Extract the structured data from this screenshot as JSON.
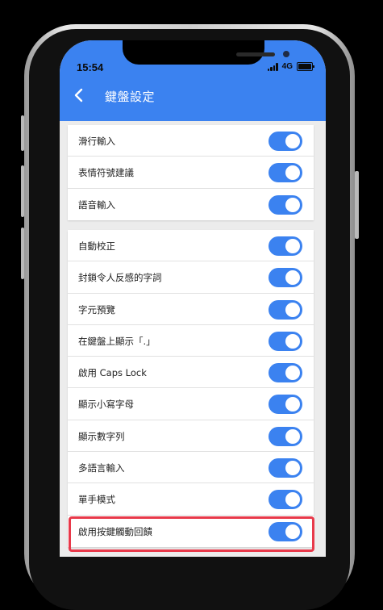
{
  "status_bar": {
    "time": "15:54",
    "network": "4G"
  },
  "header": {
    "title": "鍵盤設定"
  },
  "group1": [
    {
      "label": "滑行輸入",
      "enabled": true
    },
    {
      "label": "表情符號建議",
      "enabled": true
    },
    {
      "label": "語音輸入",
      "enabled": true
    }
  ],
  "group2": [
    {
      "label": "自動校正",
      "enabled": true
    },
    {
      "label": "封鎖令人反感的字詞",
      "enabled": true
    },
    {
      "label": "字元預覽",
      "enabled": true
    },
    {
      "label": "在鍵盤上顯示「.」",
      "enabled": true
    },
    {
      "label": "啟用 Caps Lock",
      "enabled": true
    },
    {
      "label": "顯示小寫字母",
      "enabled": true
    },
    {
      "label": "顯示數字列",
      "enabled": true
    },
    {
      "label": "多語言輸入",
      "enabled": true
    },
    {
      "label": "單手模式",
      "enabled": true
    },
    {
      "label": "啟用按鍵觸動回饋",
      "enabled": true
    }
  ],
  "colors": {
    "accent": "#3b82f0",
    "highlight": "#e8394a",
    "background": "#ececec"
  },
  "icons": {
    "back": "chevron-left-icon"
  }
}
